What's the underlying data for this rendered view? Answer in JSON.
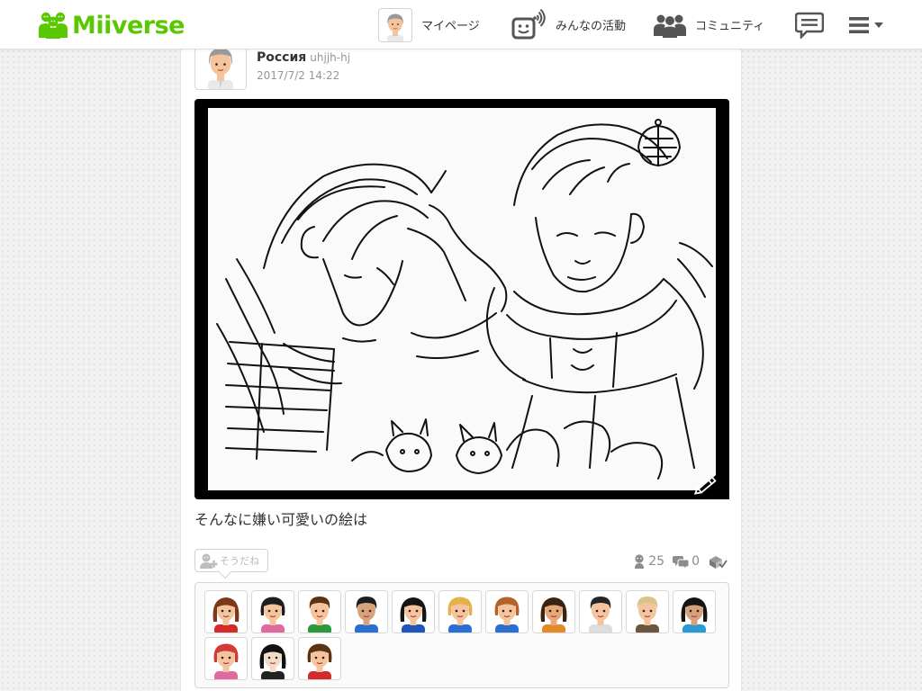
{
  "header": {
    "logo_text": "Miiverse",
    "nav": {
      "mypage_label": "マイページ",
      "activity_label": "みんなの活動",
      "community_label": "コミュニティ"
    }
  },
  "post": {
    "author_name": "Россия",
    "author_id": "uhjjh-hj",
    "timestamp": "2017/7/2 14:22",
    "body": "そんなに嫌い可愛いの絵は",
    "yeah_button_label": "そうだね",
    "yeah_count": "25",
    "comment_count": "0",
    "spoiler_icon": "spoiler-check-icon"
  },
  "yeah_miis": [
    {
      "hair": "#7a3a1a",
      "skin": "#f5c49c",
      "shirt": "#d32b2b",
      "style": "long"
    },
    {
      "hair": "#1e1e1e",
      "skin": "#f5c49c",
      "shirt": "#e06aa0",
      "style": "bob"
    },
    {
      "hair": "#5a3412",
      "skin": "#f5c49c",
      "shirt": "#2b9a3c",
      "style": "short"
    },
    {
      "hair": "#1e1e1e",
      "skin": "#d8a27a",
      "shirt": "#2b6fd3",
      "style": "short"
    },
    {
      "hair": "#151515",
      "skin": "#f5c49c",
      "shirt": "#1f56b8",
      "style": "long"
    },
    {
      "hair": "#e3b24a",
      "skin": "#f5c49c",
      "shirt": "#2b6fd3",
      "style": "bob"
    },
    {
      "hair": "#b5622a",
      "skin": "#f5c49c",
      "shirt": "#2b6fd3",
      "style": "bob"
    },
    {
      "hair": "#3a2410",
      "skin": "#e8a777",
      "shirt": "#e38a2a",
      "style": "long"
    },
    {
      "hair": "#262626",
      "skin": "#f5c49c",
      "shirt": "#dddddd",
      "style": "short"
    },
    {
      "hair": "#d9c58a",
      "skin": "#f5c49c",
      "shirt": "#6b5640",
      "style": "short"
    },
    {
      "hair": "#151515",
      "skin": "#d6a27a",
      "shirt": "#2b9ad3",
      "style": "long"
    },
    {
      "hair": "#d23a3a",
      "skin": "#f5c49c",
      "shirt": "#e06aa0",
      "style": "bob"
    },
    {
      "hair": "#111111",
      "skin": "#f1dcc8",
      "shirt": "#222222",
      "style": "long"
    },
    {
      "hair": "#5a3412",
      "skin": "#f5c49c",
      "shirt": "#d32b2b",
      "style": "bob"
    }
  ],
  "colors": {
    "brand": "#5ac800",
    "author_hair": "#9a9a9a"
  }
}
